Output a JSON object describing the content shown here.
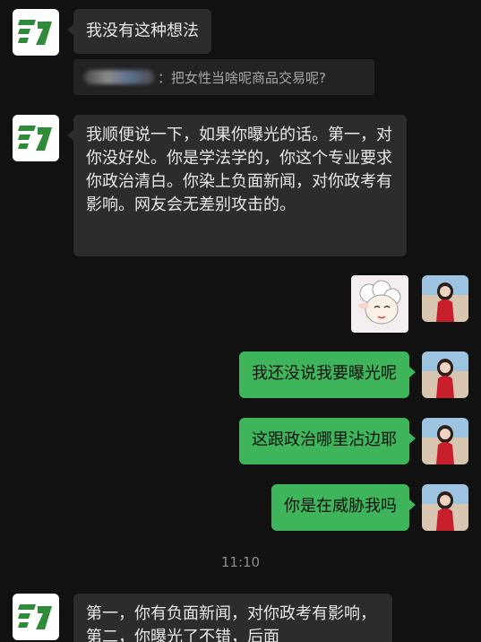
{
  "messages": [
    {
      "side": "left",
      "text": "我没有这种想法"
    },
    {
      "side": "left-quote",
      "text": "：把女性当啥呢商品交易呢?"
    },
    {
      "side": "left",
      "text": "我顺便说一下，如果你曝光的话。第一，对你没好处。你是学法学的，你这个专业要求你政治清白。你染上负面新闻，对你政考有影响。网友会无差别攻击的。"
    },
    {
      "side": "right",
      "text": "我还没说我要曝光呢"
    },
    {
      "side": "right",
      "text": "这跟政治哪里沾边耶"
    },
    {
      "side": "right",
      "text": "你是在威胁我吗"
    },
    {
      "side": "left",
      "text": "第一，你有负面新闻，对你政考有影响，第二，你曝光了不错，后面"
    }
  ],
  "timestamp": "11:10",
  "colors": {
    "background": "#111111",
    "incoming_bubble": "#2c2c2c",
    "outgoing_bubble": "#3eb55a"
  },
  "icons": {
    "left_avatar": "green-logo-avatar",
    "right_avatar": "woman-red-dress-avatar",
    "sticker": "cartoon-sheep-sticker"
  }
}
